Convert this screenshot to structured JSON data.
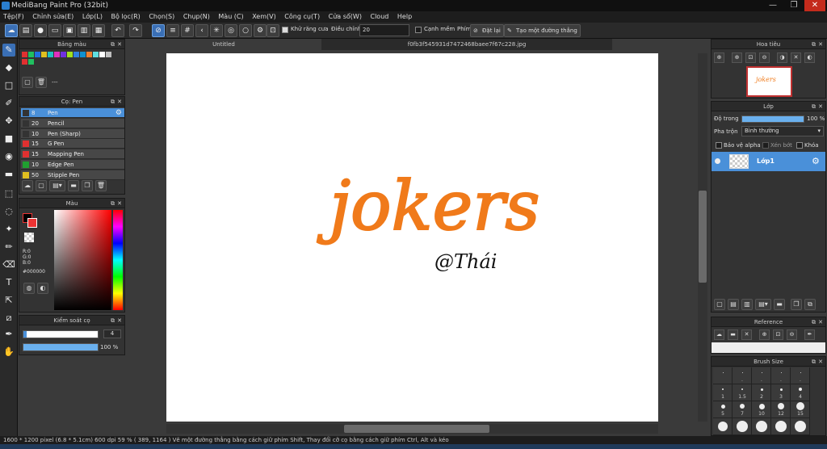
{
  "window": {
    "title": "MediBang Paint Pro (32bit)",
    "minimize": "—",
    "maximize": "❐",
    "close": "✕"
  },
  "menu": [
    "Tệp(F)",
    "Chỉnh sửa(E)",
    "Lớp(L)",
    "Bộ lọc(R)",
    "Chọn(S)",
    "Chụp(N)",
    "Màu (C)",
    "Xem(V)",
    "Công cụ(T)",
    "Cửa sổ(W)",
    "Cloud",
    "Help"
  ],
  "toolbar": {
    "antialias_label": "Khử răng cưa",
    "correction_label": "Điều chỉnh",
    "correction_value": "20",
    "edge_label": "Cạnh mềm",
    "key_label": "Phím",
    "reset_label": "Đặt lại",
    "line_label": "Tạo một đường thẳng"
  },
  "colors": {
    "accent": "#4a90d9",
    "canvas": "#ffffff",
    "stroke": "#f07a1a"
  },
  "palette_panel": {
    "title": "Bảng màu",
    "dash": "---"
  },
  "brush_panel": {
    "title": "Cọ: Pen",
    "brushes": [
      {
        "size": "8",
        "name": "Pen",
        "color": "#333333"
      },
      {
        "size": "20",
        "name": "Pencil",
        "color": "#333333"
      },
      {
        "size": "10",
        "name": "Pen (Sharp)",
        "color": "#333333"
      },
      {
        "size": "15",
        "name": "G Pen",
        "color": "#e03030"
      },
      {
        "size": "15",
        "name": "Mapping Pen",
        "color": "#e03030"
      },
      {
        "size": "10",
        "name": "Edge Pen",
        "color": "#20a030"
      },
      {
        "size": "50",
        "name": "Stipple Pen",
        "color": "#e0c020"
      }
    ]
  },
  "color_panel": {
    "title": "Màu",
    "r": "R:0",
    "g": "G:0",
    "b": "B:0",
    "hex": "#000000"
  },
  "brush_control": {
    "title": "Kiểm soát cọ",
    "size": "4",
    "opacity": "100 %",
    "opacity_fraction": 1.0
  },
  "tabs": {
    "untitled": "Untitled",
    "file": "f0fb3f545931d7472468baee7f67c228.jpg"
  },
  "canvas": {
    "text_main": "jokers",
    "text_sig": "@Thái"
  },
  "navigator": {
    "title": "Hoa tiêu",
    "thumb_text": "jokers"
  },
  "layer_panel": {
    "title": "Lớp",
    "opacity_label": "Độ trong",
    "opacity_value": "100 %",
    "blend_label": "Pha trộn",
    "blend_value": "Bình thường",
    "protect_alpha": "Bảo vệ alpha",
    "clipping": "Xén bớt",
    "lock": "Khóa",
    "layer_name": "Lớp1"
  },
  "reference": {
    "title": "Reference"
  },
  "brush_size": {
    "title": "Brush Size",
    "rows": [
      [
        "",
        ".",
        ".",
        ".",
        "."
      ],
      [
        "1",
        "1.5",
        "2",
        "3",
        "4"
      ],
      [
        "5",
        "7",
        "10",
        "12",
        "15"
      ],
      [
        "",
        "",
        "",
        "",
        ""
      ]
    ]
  },
  "status": {
    "text": "1600 * 1200 pixel   (6.8 * 5.1cm)   600 dpi   59 %   ( 389, 1164 )   Vẽ một đường thẳng bằng cách giữ phím Shift, Thay đổi cỡ cọ bằng cách giữ phím Ctrl, Alt và kéo"
  }
}
